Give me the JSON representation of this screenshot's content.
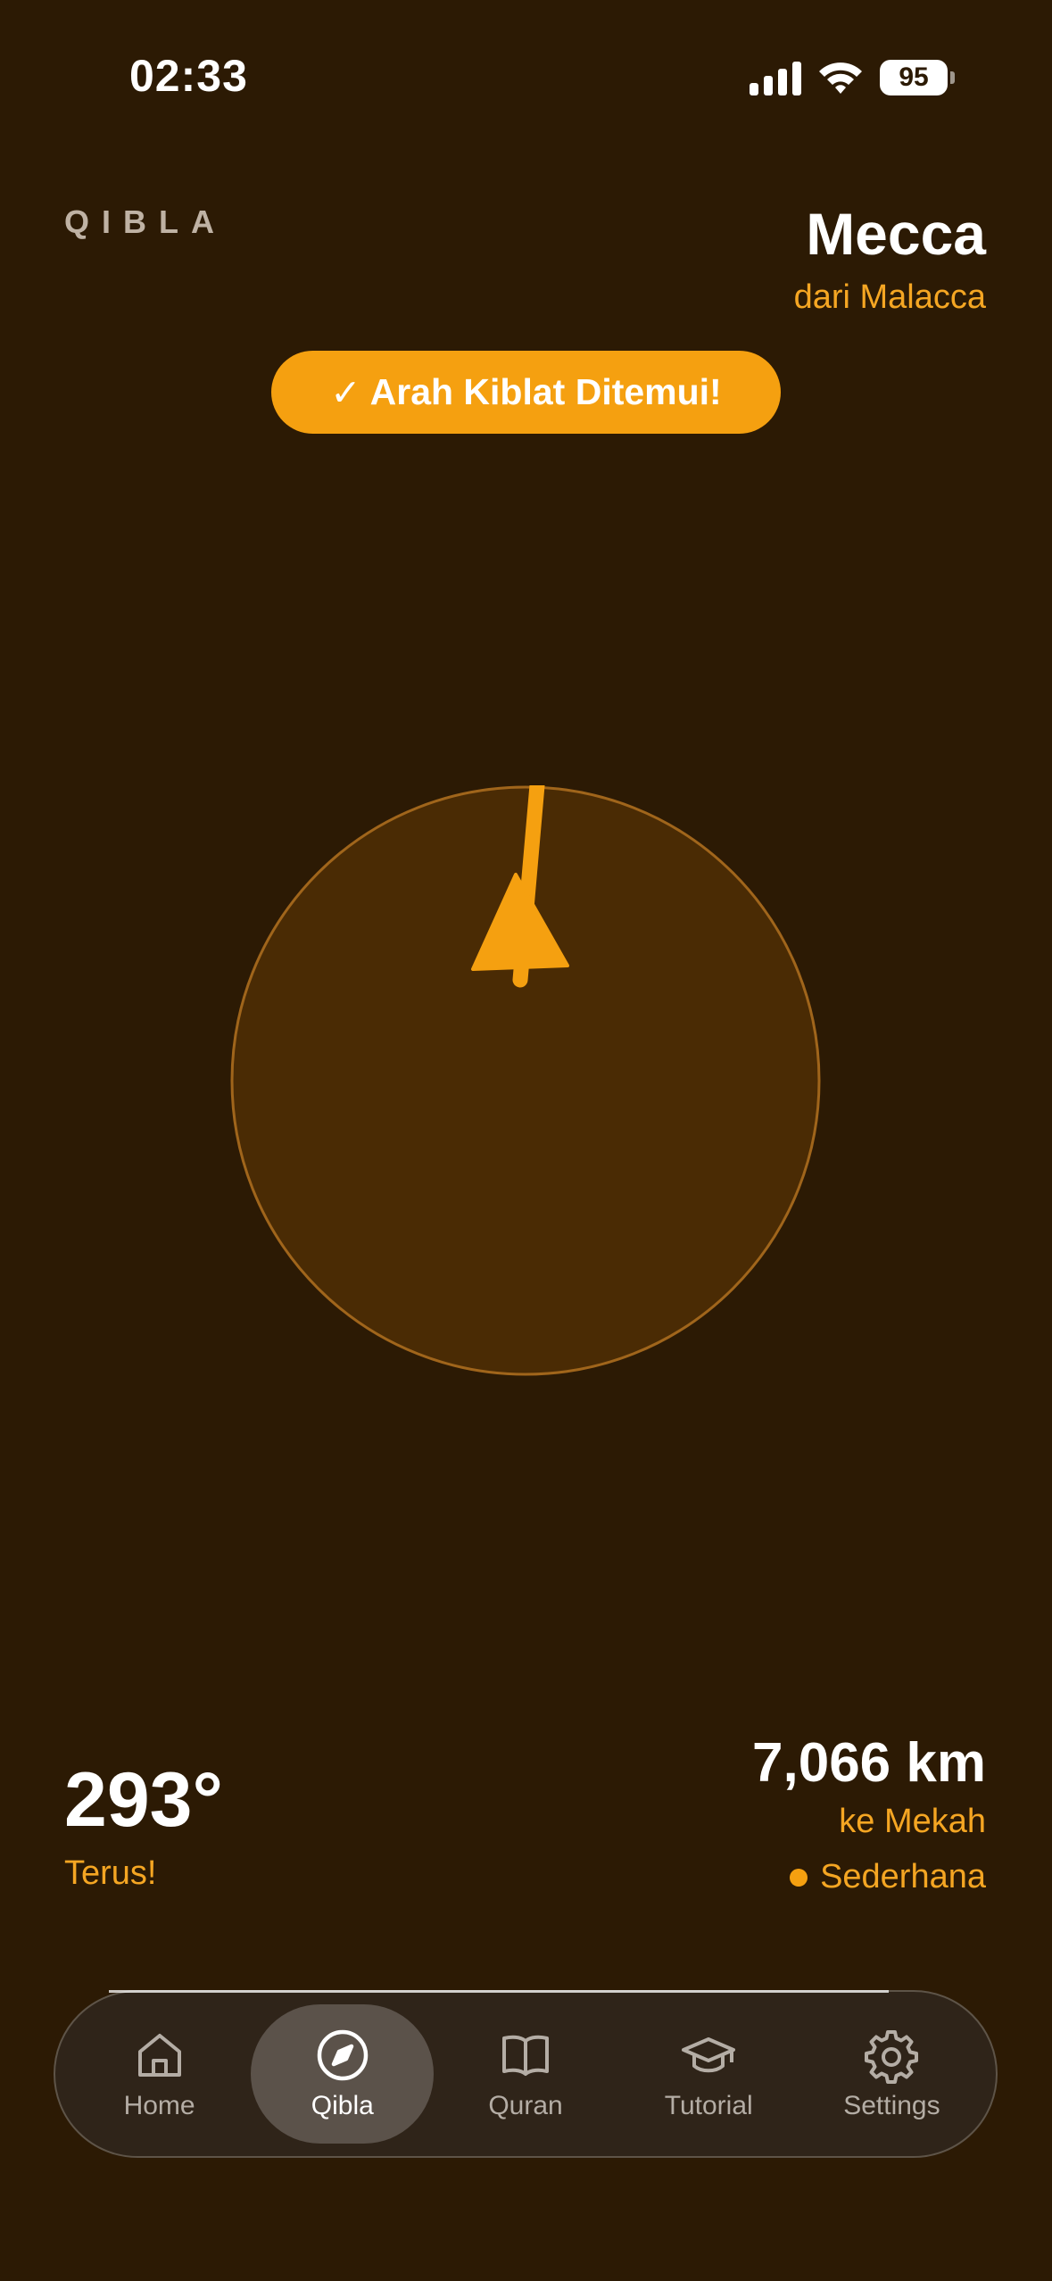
{
  "status_bar": {
    "time": "02:33",
    "battery": "95"
  },
  "header": {
    "section_label": "QIBLA",
    "destination": "Mecca",
    "from": "dari Malacca"
  },
  "found_banner": {
    "check": "✓",
    "text": "Arah Kiblat Ditemui!"
  },
  "compass": {
    "accent_color": "#f5a010",
    "needle": "qibla-arrow-icon"
  },
  "heading": {
    "degrees": "293°",
    "hint": "Terus!"
  },
  "distance": {
    "value": "7,066 km",
    "label": "ke Mekah",
    "accuracy": "Sederhana"
  },
  "tabs": [
    {
      "label": "Home",
      "icon": "home-icon",
      "active": false
    },
    {
      "label": "Qibla",
      "icon": "compass-icon",
      "active": true
    },
    {
      "label": "Quran",
      "icon": "book-icon",
      "active": false
    },
    {
      "label": "Tutorial",
      "icon": "graduation-cap-icon",
      "active": false
    },
    {
      "label": "Settings",
      "icon": "gear-icon",
      "active": false
    }
  ],
  "colors": {
    "background": "#2c1a04",
    "accent": "#f5a010",
    "accent_text": "#f5a623"
  }
}
